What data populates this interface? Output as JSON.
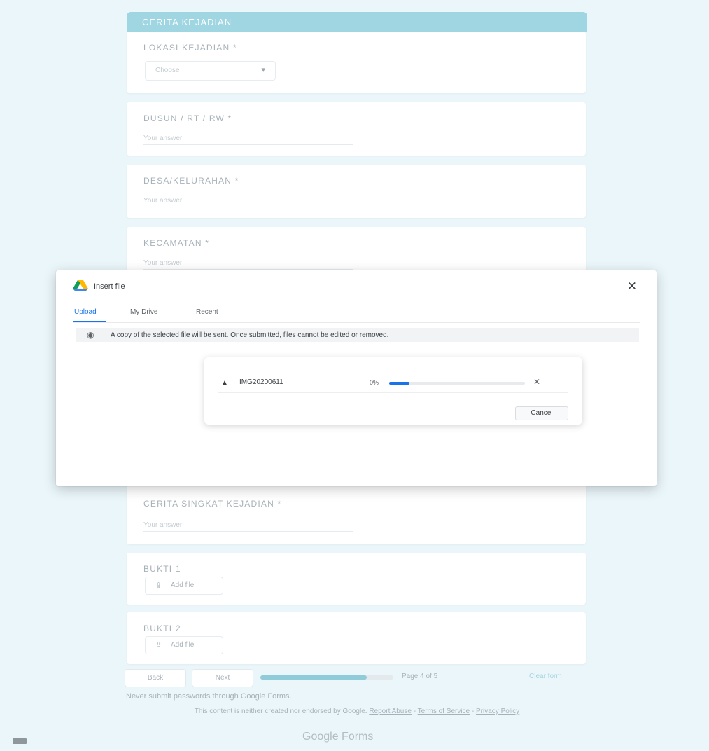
{
  "form": {
    "section_title": "CERITA KEJADIAN",
    "questions": [
      {
        "title": "LOKASI KEJADIAN *",
        "type": "select",
        "value": "Choose"
      },
      {
        "title": "DUSUN / RT / RW *",
        "type": "text",
        "placeholder": "Your answer"
      },
      {
        "title": "DESA/KELURAHAN *",
        "type": "text",
        "placeholder": "Your answer"
      },
      {
        "title": "KECAMATAN *",
        "type": "text",
        "placeholder": "Your answer"
      },
      {
        "title": "CERITA SINGKAT KEJADIAN *",
        "type": "text",
        "placeholder": "Your answer"
      },
      {
        "title": "BUKTI 1",
        "type": "file",
        "button": "Add file"
      },
      {
        "title": "BUKTI 2",
        "type": "file",
        "button": "Add file"
      }
    ]
  },
  "dialog": {
    "title": "Insert file",
    "close_icon": "close-icon",
    "tabs": [
      "Upload",
      "My Drive",
      "Recent"
    ],
    "active_tab": "Upload",
    "notice": "A copy of the selected file will be sent. Once submitted, files cannot be edited or removed.",
    "upload": {
      "file_name": "IMG20200611",
      "progress_label": "0%",
      "progress": 0.15,
      "cancel_label": "Cancel"
    }
  },
  "footer": {
    "back_label": "Back",
    "next_label": "Next",
    "form_progress": 0.8,
    "page_label": "Page 4 of 5",
    "clear_label": "Clear form",
    "never_submit": "Never submit passwords through Google Forms.",
    "disclaimer_prefix": "This content is neither created nor endorsed by Google.",
    "report_abuse": "Report Abuse",
    "terms": "Terms of Service",
    "privacy": "Privacy Policy",
    "brand": "Google Forms"
  },
  "colors": {
    "page_bg": "#eaf6fa",
    "section_header": "#9fd6e2",
    "accent_blue": "#1a73e8",
    "progress_fill": "#8fcbd8"
  }
}
